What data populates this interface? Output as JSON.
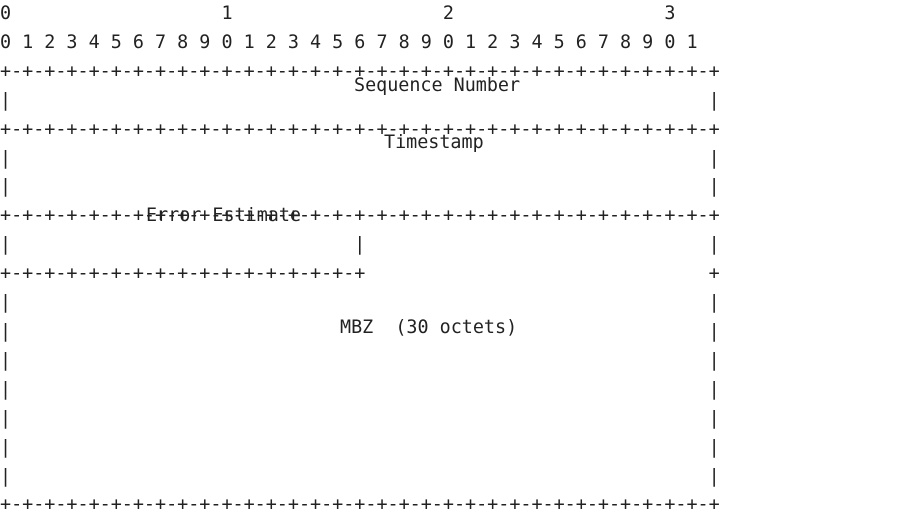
{
  "ruler": {
    "tens": "0                   1                   2                   3",
    "units": "0 1 2 3 4 5 6 7 8 9 0 1 2 3 4 5 6 7 8 9 0 1 2 3 4 5 6 7 8 9 0 1"
  },
  "fields": {
    "sequence_number": "Sequence Number",
    "timestamp": "Timestamp",
    "error_estimate": "Error Estimate",
    "mbz": "MBZ  (30 octets)"
  }
}
